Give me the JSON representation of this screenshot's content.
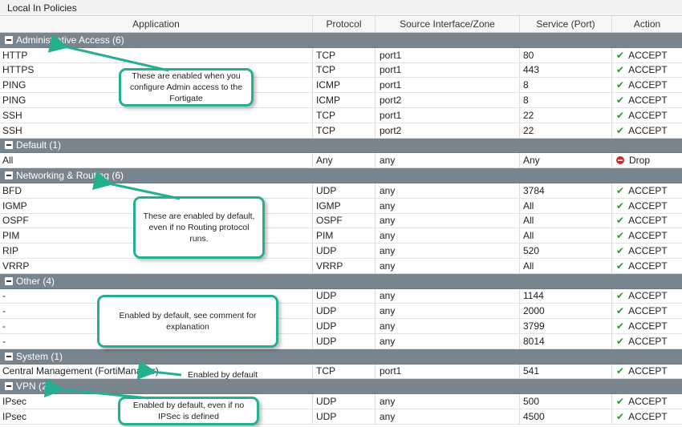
{
  "window": {
    "title": "Local In Policies"
  },
  "columns": [
    "Application",
    "Protocol",
    "Source Interface/Zone",
    "Service (Port)",
    "Action"
  ],
  "groups": [
    {
      "label": "Administrative Access (6)",
      "rows": [
        {
          "app": "HTTP",
          "protocol": "TCP",
          "source": "port1",
          "service": "80",
          "action": "ACCEPT"
        },
        {
          "app": "HTTPS",
          "protocol": "TCP",
          "source": "port1",
          "service": "443",
          "action": "ACCEPT"
        },
        {
          "app": "PING",
          "protocol": "ICMP",
          "source": "port1",
          "service": "8",
          "action": "ACCEPT"
        },
        {
          "app": "PING",
          "protocol": "ICMP",
          "source": "port2",
          "service": "8",
          "action": "ACCEPT"
        },
        {
          "app": "SSH",
          "protocol": "TCP",
          "source": "port1",
          "service": "22",
          "action": "ACCEPT"
        },
        {
          "app": "SSH",
          "protocol": "TCP",
          "source": "port2",
          "service": "22",
          "action": "ACCEPT"
        }
      ]
    },
    {
      "label": "Default (1)",
      "rows": [
        {
          "app": "All",
          "protocol": "Any",
          "source": "any",
          "service": "Any",
          "action": "Drop"
        }
      ]
    },
    {
      "label": "Networking & Routing (6)",
      "rows": [
        {
          "app": "BFD",
          "protocol": "UDP",
          "source": "any",
          "service": "3784",
          "action": "ACCEPT"
        },
        {
          "app": "IGMP",
          "protocol": "IGMP",
          "source": "any",
          "service": "All",
          "action": "ACCEPT"
        },
        {
          "app": "OSPF",
          "protocol": "OSPF",
          "source": "any",
          "service": "All",
          "action": "ACCEPT"
        },
        {
          "app": "PIM",
          "protocol": "PIM",
          "source": "any",
          "service": "All",
          "action": "ACCEPT"
        },
        {
          "app": "RIP",
          "protocol": "UDP",
          "source": "any",
          "service": "520",
          "action": "ACCEPT"
        },
        {
          "app": "VRRP",
          "protocol": "VRRP",
          "source": "any",
          "service": "All",
          "action": "ACCEPT"
        }
      ]
    },
    {
      "label": "Other (4)",
      "rows": [
        {
          "app": "-",
          "protocol": "UDP",
          "source": "any",
          "service": "1144",
          "action": "ACCEPT"
        },
        {
          "app": "-",
          "protocol": "UDP",
          "source": "any",
          "service": "2000",
          "action": "ACCEPT"
        },
        {
          "app": "-",
          "protocol": "UDP",
          "source": "any",
          "service": "3799",
          "action": "ACCEPT"
        },
        {
          "app": "-",
          "protocol": "UDP",
          "source": "any",
          "service": "8014",
          "action": "ACCEPT"
        }
      ]
    },
    {
      "label": "System (1)",
      "rows": [
        {
          "app": "Central Management (FortiManager)",
          "protocol": "TCP",
          "source": "port1",
          "service": "541",
          "action": "ACCEPT"
        }
      ]
    },
    {
      "label": "VPN (2)",
      "rows": [
        {
          "app": "IPsec",
          "protocol": "UDP",
          "source": "any",
          "service": "500",
          "action": "ACCEPT"
        },
        {
          "app": "IPsec",
          "protocol": "UDP",
          "source": "any",
          "service": "4500",
          "action": "ACCEPT"
        }
      ]
    }
  ],
  "annotations": {
    "admin": "These are enabled when you configure Admin access to the Fortigate",
    "routing": "These are enabled by default, even if no Routing protocol runs.",
    "other": "Enabled by default, see comment for explanation",
    "system": "Enabled by default",
    "vpn": "Enabled by default, even if no IPSec is defined"
  },
  "colors": {
    "group_header": "#78858e",
    "accept_check": "#2a9b2a",
    "drop": "#d8261f",
    "callout_border": "#24b090"
  }
}
